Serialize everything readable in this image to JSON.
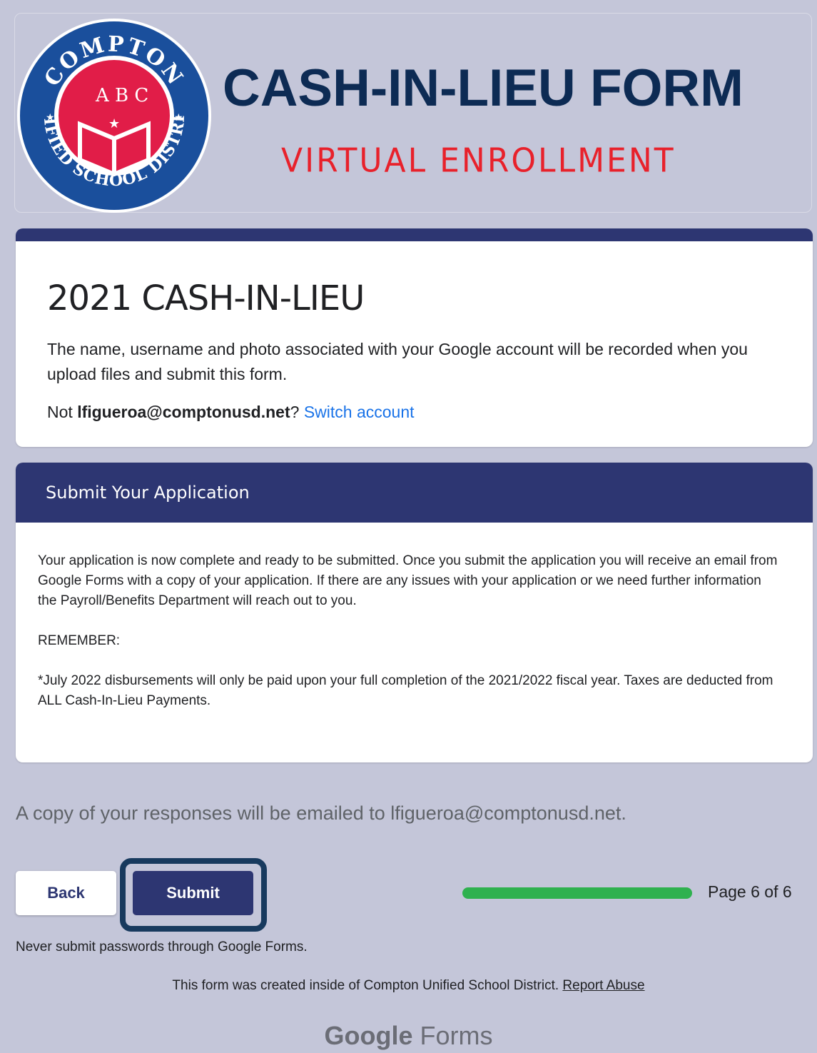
{
  "banner": {
    "seal": {
      "top_text": "COMPTON",
      "bottom_text": "UNIFIED SCHOOL DISTRICT",
      "colors": {
        "ring": "#1a4f9c",
        "center": "#e11d48"
      }
    },
    "title": "CASH-IN-LIEU FORM",
    "subtitle": "VIRTUAL ENROLLMENT"
  },
  "form": {
    "title": "2021 CASH-IN-LIEU",
    "notice": "The name, username and photo associated with your Google account will be recorded when you upload files and submit this form.",
    "account_prefix": "Not ",
    "account_email": "lfigueroa@comptonusd.net",
    "account_suffix": "? ",
    "switch_account": "Switch account"
  },
  "section": {
    "heading": "Submit Your Application",
    "paragraphs": [
      "Your application is now complete and ready to be submitted. Once you submit the application you will receive an email from Google Forms with a copy of your application. If there are any issues with your application or we need further information the Payroll/Benefits Department will reach out to you.",
      "REMEMBER:",
      "*July 2022 disbursements will only be paid upon your full completion of the 2021/2022 fiscal year. Taxes are deducted from ALL Cash-In-Lieu Payments."
    ]
  },
  "copy_note": "A copy of your responses will be emailed to lfigueroa@comptonusd.net.",
  "nav": {
    "back_label": "Back",
    "submit_label": "Submit",
    "progress_fraction": 1.0,
    "page_label": "Page 6 of 6"
  },
  "password_note": "Never submit passwords through Google Forms.",
  "footer": {
    "text": "This form was created inside of Compton Unified School District. ",
    "report_abuse": "Report Abuse"
  },
  "brand": {
    "google": "Google",
    "forms": " Forms"
  },
  "colors": {
    "background": "#c4c6d9",
    "accent": "#2d3672",
    "progress": "#2fb14f",
    "link": "#1a73e8",
    "banner_title": "#0d2b54",
    "banner_subtitle": "#e8212b"
  }
}
